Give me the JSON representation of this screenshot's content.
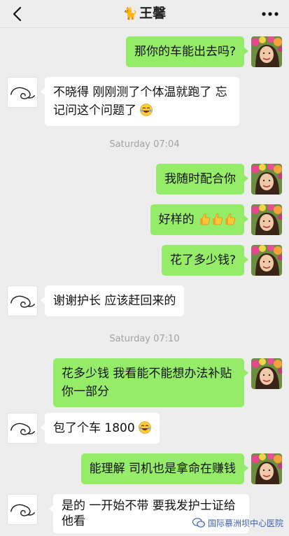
{
  "header": {
    "title_emoji": "🐈",
    "title": "王馨"
  },
  "messages": [
    {
      "side": "me",
      "text": "那你的车能出去吗?"
    },
    {
      "side": "them",
      "text": "不晓得 刚刚测了个体温就跑了 忘记问这个问题了"
    },
    {
      "side": "time",
      "text": "Saturday 07:04"
    },
    {
      "side": "me",
      "text": "我随时配合你"
    },
    {
      "side": "me",
      "text": "好样的"
    },
    {
      "side": "me",
      "text": "花了多少钱?"
    },
    {
      "side": "them",
      "text": "谢谢护长 应该赶回来的"
    },
    {
      "side": "time",
      "text": "Saturday 07:10"
    },
    {
      "side": "me",
      "text": "花多少钱 我看能不能想办法补贴你一部分"
    },
    {
      "side": "them",
      "text": "包了个车 1800"
    },
    {
      "side": "me",
      "text": "能理解 司机也是拿命在赚钱"
    },
    {
      "side": "them",
      "text": "是的 一开始不带 要我发护士证给他看"
    }
  ],
  "watermark": {
    "text": "国际慕洲坝中心医院",
    "icon": "wechat-official-account-icon"
  },
  "colors": {
    "background": "#ededed",
    "my_bubble": "#95ec69",
    "their_bubble": "#ffffff"
  }
}
